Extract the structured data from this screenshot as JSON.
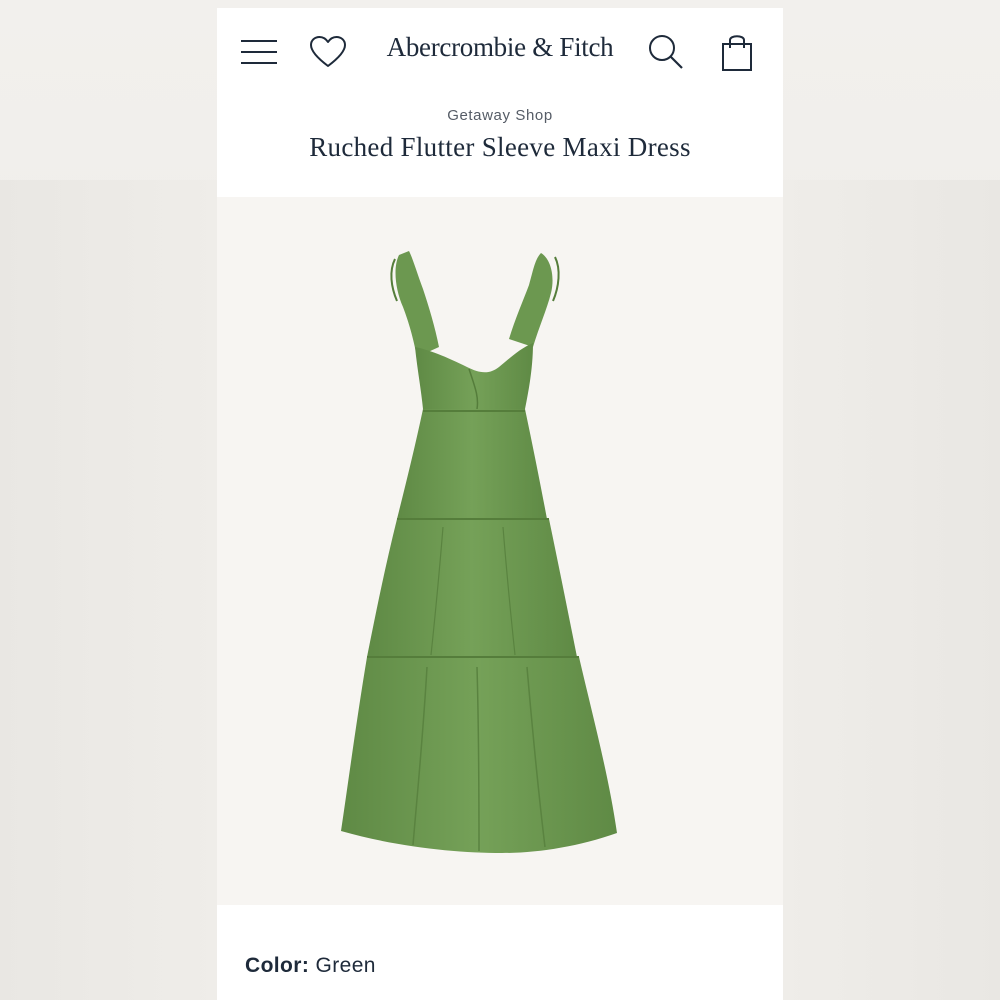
{
  "header": {
    "logo": "Abercrombie & Fitch",
    "icons": [
      "menu-icon",
      "heart-icon",
      "search-icon",
      "shopping-bag-icon"
    ]
  },
  "product": {
    "shop_label": "Getaway Shop",
    "title": "Ruched Flutter Sleeve Maxi Dress",
    "image_subject": "green-tiered-maxi-dress",
    "color_label": "Color:",
    "color_value": "Green"
  },
  "colors": {
    "brand_navy": "#1e2a3a",
    "dress_green": "#6f9a52",
    "image_background": "#f7f5f2"
  }
}
